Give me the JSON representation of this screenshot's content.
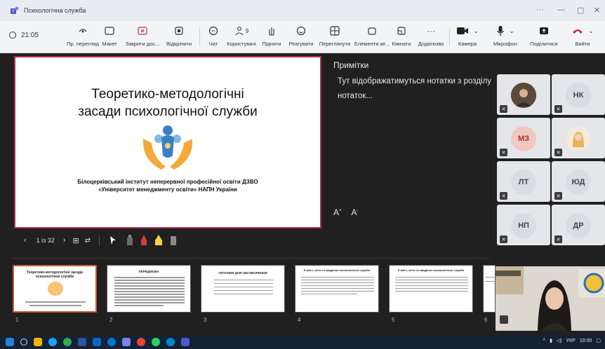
{
  "window": {
    "title": "Психологічна служба"
  },
  "toolbar": {
    "timer": "21:05",
    "items": [
      {
        "label": "Пр. перегляд",
        "icon": "eye-icon"
      },
      {
        "label": "Макет",
        "icon": "layout-icon"
      },
      {
        "label": "Закрити дос...",
        "icon": "close-share-icon"
      },
      {
        "label": "Відкріпити",
        "icon": "unpin-icon"
      },
      {
        "label": "Чат",
        "icon": "chat-icon"
      },
      {
        "label": "Користувачі",
        "icon": "people-icon",
        "badge": "9"
      },
      {
        "label": "Підняти",
        "icon": "hand-icon"
      },
      {
        "label": "Реагувати",
        "icon": "emoji-icon"
      },
      {
        "label": "Переглянути",
        "icon": "view-icon"
      },
      {
        "label": "Елементи ке...",
        "icon": "apps-icon"
      },
      {
        "label": "Кімнати",
        "icon": "rooms-icon"
      },
      {
        "label": "Додатково",
        "icon": "more-icon"
      },
      {
        "label": "Камера",
        "icon": "camera-icon"
      },
      {
        "label": "Мікрофон",
        "icon": "microphone-icon"
      },
      {
        "label": "Поділитися",
        "icon": "share-icon"
      },
      {
        "label": "Вийти",
        "icon": "leave-call-icon"
      }
    ]
  },
  "slide": {
    "title_line1": "Теоретико-методологічні",
    "title_line2": "засади психологічної служби",
    "org_line1": "Білоцерківський інститут неперервної професійної освіти  ДЗВО",
    "org_line2": "«Університет менеджменту освіти» НАПН України"
  },
  "notes": {
    "title": "Примітки",
    "body": "Тут відображатимуться нотатки з розділу нотаток...",
    "font_controls": "A+ A-"
  },
  "slide_controls": {
    "counter": "1 із 32"
  },
  "thumbnails": [
    {
      "num": "1",
      "title": "Теоретико-методологічні засади психологічної служби",
      "selected": true
    },
    {
      "num": "2",
      "title": "ПЕРЕДМОВА"
    },
    {
      "num": "3",
      "title": "ПИТАННЯ ДЛЯ ОБГОВОРЕННЯ"
    },
    {
      "num": "4",
      "title": "Її зміст, мета та завдання психологічної служби"
    },
    {
      "num": "5",
      "title": "Її зміст, мета та завдання психологічної служби"
    },
    {
      "num": "6",
      "title": ""
    }
  ],
  "participants": [
    {
      "initials": "",
      "photo": true
    },
    {
      "initials": "НК"
    },
    {
      "initials": "МЗ",
      "color": "#f2c6c2",
      "text_color": "#a3332d"
    },
    {
      "initials": "",
      "photo": true
    },
    {
      "initials": "ЛТ"
    },
    {
      "initials": "ЮД"
    },
    {
      "initials": "НП"
    },
    {
      "initials": "ДР"
    }
  ],
  "taskbar": {
    "lang": "УКР",
    "time": "10:00"
  },
  "colors": {
    "accent": "#b2304c",
    "leave": "#c4314b"
  }
}
